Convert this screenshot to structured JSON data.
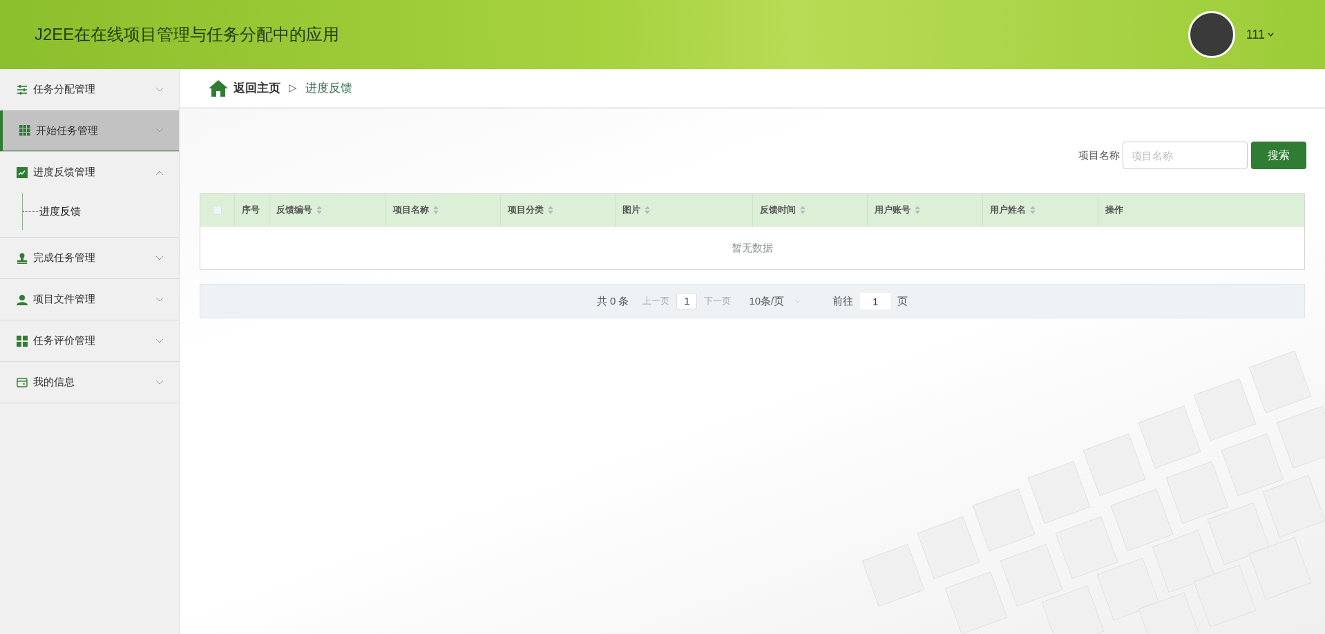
{
  "header": {
    "title": "J2EE在在线项目管理与任务分配中的应用",
    "user": {
      "name": "111"
    }
  },
  "sidebar": {
    "items": [
      {
        "label": "任务分配管理",
        "selected": false,
        "expanded": false
      },
      {
        "label": "开始任务管理",
        "selected": true,
        "expanded": false
      },
      {
        "label": "进度反馈管理",
        "selected": false,
        "expanded": true,
        "children": [
          {
            "label": "进度反馈",
            "selected": false
          }
        ]
      },
      {
        "label": "完成任务管理",
        "selected": false,
        "expanded": false
      },
      {
        "label": "项目文件管理",
        "selected": false,
        "expanded": false
      },
      {
        "label": "任务评价管理",
        "selected": false,
        "expanded": false
      },
      {
        "label": "我的信息",
        "selected": false,
        "expanded": false
      }
    ]
  },
  "breadcrumb": {
    "home": "返回主页",
    "separator": "▷",
    "current": "进度反馈"
  },
  "search": {
    "label": "项目名称",
    "placeholder": "项目名称",
    "button": "搜索"
  },
  "table": {
    "select_all": {
      "checked": false
    },
    "columns": [
      {
        "label": "序号",
        "sortable": false
      },
      {
        "label": "反馈编号",
        "sortable": true
      },
      {
        "label": "项目名称",
        "sortable": true
      },
      {
        "label": "项目分类",
        "sortable": true
      },
      {
        "label": "图片",
        "sortable": true
      },
      {
        "label": "反馈时间",
        "sortable": true
      },
      {
        "label": "用户账号",
        "sortable": true
      },
      {
        "label": "用户姓名",
        "sortable": true
      },
      {
        "label": "操作",
        "sortable": false
      }
    ],
    "empty_text": "暂无数据"
  },
  "pagination": {
    "total": "共 0 条",
    "prev": "上一页",
    "page": "1",
    "next": "下一页",
    "page_size": "10条/页",
    "goto_label": "前往",
    "goto_value": "1",
    "goto_suffix": "页"
  }
}
